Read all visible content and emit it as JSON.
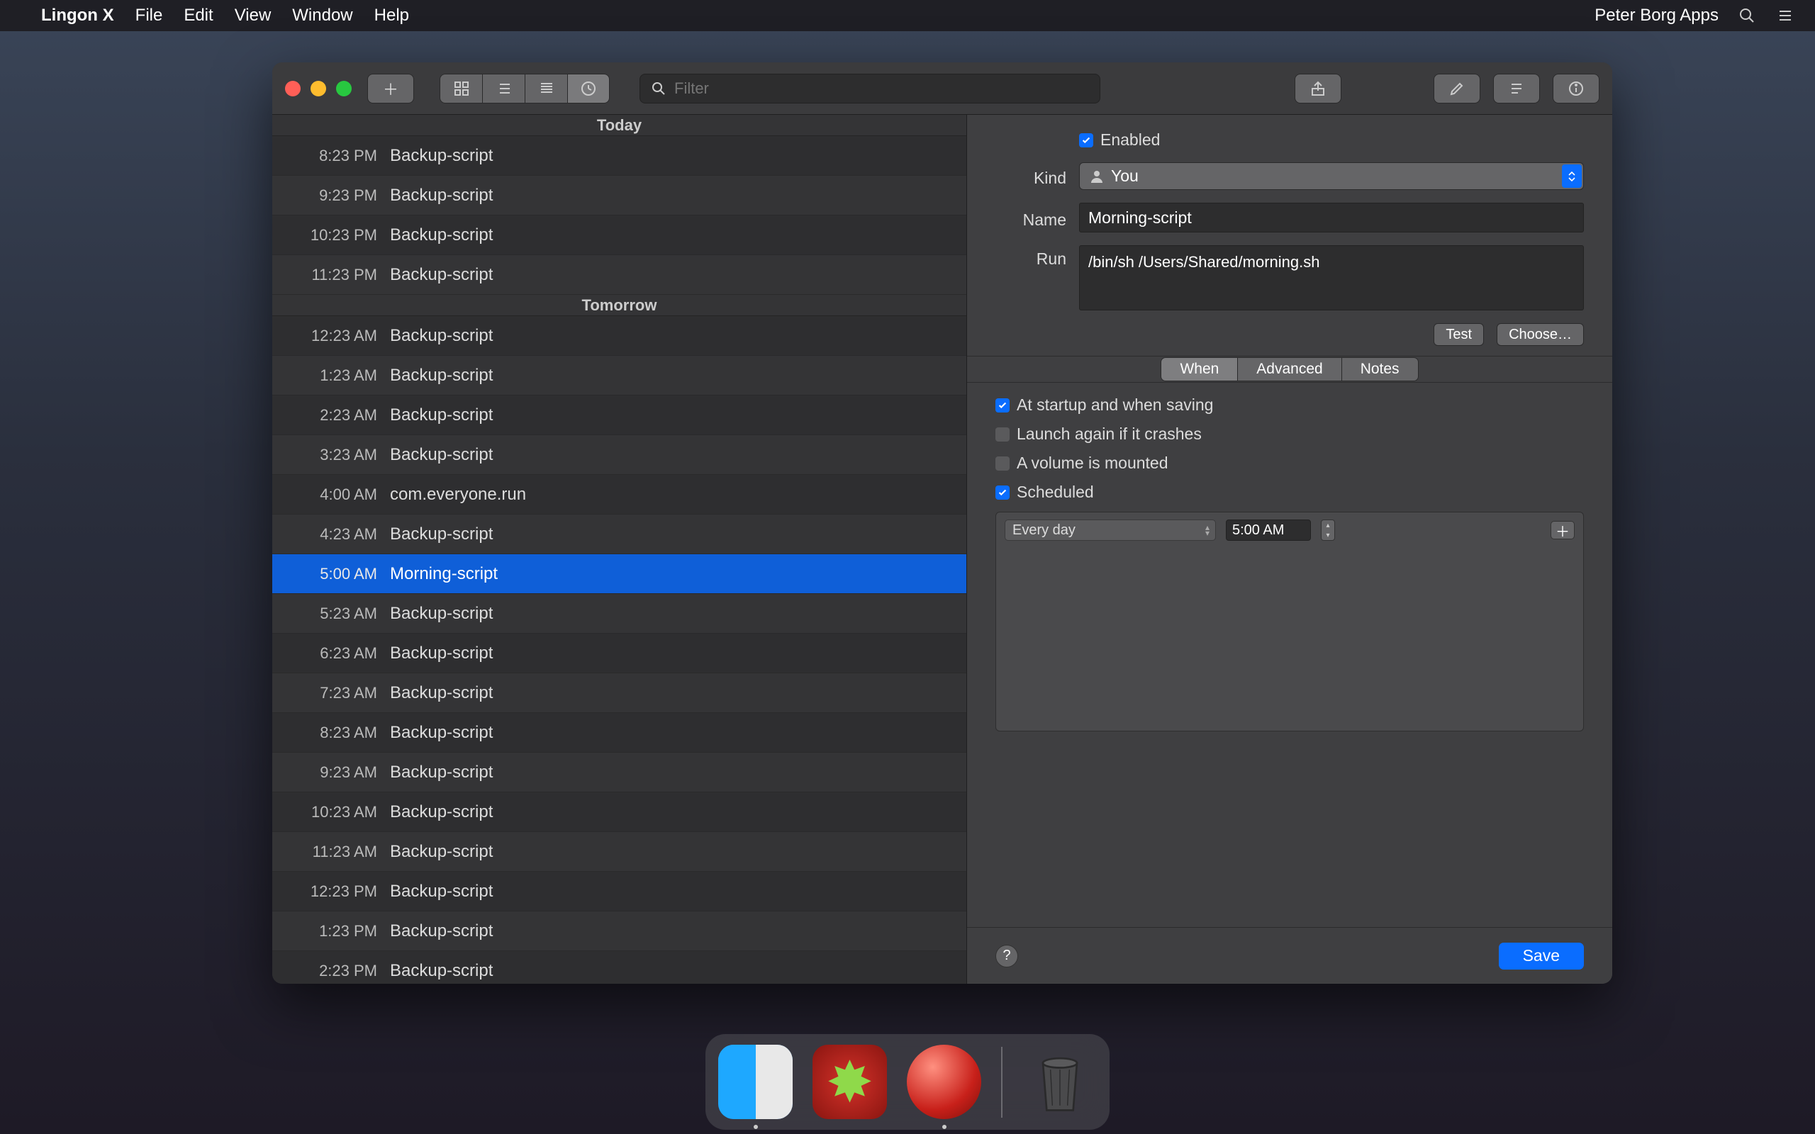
{
  "menubar": {
    "app": "Lingon X",
    "items": [
      "File",
      "Edit",
      "View",
      "Window",
      "Help"
    ],
    "right_text": "Peter Borg Apps"
  },
  "toolbar": {
    "search_placeholder": "Filter"
  },
  "list": {
    "sections": [
      {
        "title": "Today",
        "items": [
          {
            "time": "8:23 PM",
            "name": "Backup-script"
          },
          {
            "time": "9:23 PM",
            "name": "Backup-script"
          },
          {
            "time": "10:23 PM",
            "name": "Backup-script"
          },
          {
            "time": "11:23 PM",
            "name": "Backup-script"
          }
        ]
      },
      {
        "title": "Tomorrow",
        "items": [
          {
            "time": "12:23 AM",
            "name": "Backup-script"
          },
          {
            "time": "1:23 AM",
            "name": "Backup-script"
          },
          {
            "time": "2:23 AM",
            "name": "Backup-script"
          },
          {
            "time": "3:23 AM",
            "name": "Backup-script"
          },
          {
            "time": "4:00 AM",
            "name": "com.everyone.run"
          },
          {
            "time": "4:23 AM",
            "name": "Backup-script"
          },
          {
            "time": "5:00 AM",
            "name": "Morning-script",
            "selected": true
          },
          {
            "time": "5:23 AM",
            "name": "Backup-script"
          },
          {
            "time": "6:23 AM",
            "name": "Backup-script"
          },
          {
            "time": "7:23 AM",
            "name": "Backup-script"
          },
          {
            "time": "8:23 AM",
            "name": "Backup-script"
          },
          {
            "time": "9:23 AM",
            "name": "Backup-script"
          },
          {
            "time": "10:23 AM",
            "name": "Backup-script"
          },
          {
            "time": "11:23 AM",
            "name": "Backup-script"
          },
          {
            "time": "12:23 PM",
            "name": "Backup-script"
          },
          {
            "time": "1:23 PM",
            "name": "Backup-script"
          },
          {
            "time": "2:23 PM",
            "name": "Backup-script"
          }
        ]
      }
    ]
  },
  "detail": {
    "enabled_label": "Enabled",
    "enabled": true,
    "kind_label": "Kind",
    "kind_value": "You",
    "name_label": "Name",
    "name_value": "Morning-script",
    "run_label": "Run",
    "run_value": "/bin/sh /Users/Shared/morning.sh",
    "test_label": "Test",
    "choose_label": "Choose…",
    "tabs": [
      "When",
      "Advanced",
      "Notes"
    ],
    "active_tab": 0,
    "when": {
      "startup_label": "At startup and when saving",
      "startup": true,
      "relaunch_label": "Launch again if it crashes",
      "relaunch": false,
      "volume_label": "A volume is mounted",
      "volume": false,
      "scheduled_label": "Scheduled",
      "scheduled": true,
      "interval_value": "Every day",
      "time_value": "5:00 AM"
    },
    "save_label": "Save"
  }
}
